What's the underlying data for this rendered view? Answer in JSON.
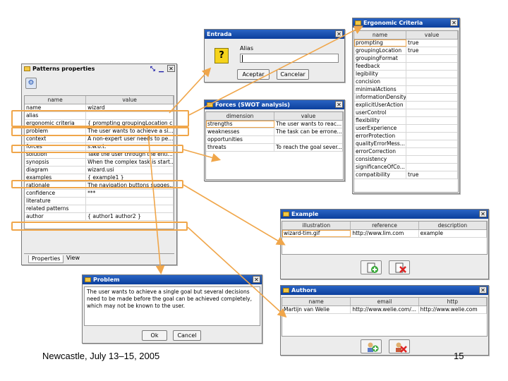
{
  "colors": {
    "titlebar": "#1b4fb0",
    "highlight": "#f0a64a",
    "window_bg": "#ececec"
  },
  "patterns_window": {
    "title": "Patterns properties",
    "columns": [
      "name",
      "value"
    ],
    "rows": [
      [
        "name",
        "wizard"
      ],
      [
        "alias",
        ""
      ],
      [
        "ergonomic criteria",
        "{ prompting groupingLocation c..."
      ],
      [
        "problem",
        "The user wants to achieve a si..."
      ],
      [
        "context",
        "A non-expert user needs to pe..."
      ],
      [
        "forces",
        "s.w.o.t."
      ],
      [
        "solution",
        "Take the user through the enti..."
      ],
      [
        "synopsis",
        "When the complex task is start..."
      ],
      [
        "diagram",
        "wizard.usi"
      ],
      [
        "examples",
        "{ example1 }"
      ],
      [
        "rationale",
        "The navigation buttons sugges..."
      ],
      [
        "confidence",
        "***"
      ],
      [
        "literature",
        ""
      ],
      [
        "related patterns",
        ""
      ],
      [
        "author",
        "{ author1 author2 }"
      ]
    ],
    "tabs": [
      "Properties",
      "View"
    ]
  },
  "entrada_window": {
    "title": "Entrada",
    "field_label": "Alias",
    "field_value": "",
    "icon_glyph": "?",
    "accept_label": "Aceptar",
    "cancel_label": "Cancelar"
  },
  "ergonomic_window": {
    "title": "Ergonomic Criteria",
    "columns": [
      "name",
      "value"
    ],
    "rows": [
      [
        "prompting",
        "true"
      ],
      [
        "groupingLocation",
        "true"
      ],
      [
        "groupingFormat",
        ""
      ],
      [
        "feedback",
        ""
      ],
      [
        "legibility",
        ""
      ],
      [
        "concision",
        ""
      ],
      [
        "minimalActions",
        ""
      ],
      [
        "informationDensity",
        ""
      ],
      [
        "explicitUserAction",
        ""
      ],
      [
        "userControl",
        ""
      ],
      [
        "flexibility",
        ""
      ],
      [
        "userExperience",
        ""
      ],
      [
        "errorProtection",
        ""
      ],
      [
        "qualityErrorMess...",
        ""
      ],
      [
        "errorCorrection",
        ""
      ],
      [
        "consistency",
        ""
      ],
      [
        "significanceOfCo...",
        ""
      ],
      [
        "compatibility",
        "true"
      ]
    ]
  },
  "forces_window": {
    "title": "Forces (SWOT analysis)",
    "columns": [
      "dimension",
      "value"
    ],
    "rows": [
      [
        "strengths",
        "The user wants to reac..."
      ],
      [
        "weaknesses",
        "The task can be errone..."
      ],
      [
        "opportunities",
        ""
      ],
      [
        "threats",
        "To reach the goal sever..."
      ]
    ]
  },
  "example_window": {
    "title": "Example",
    "columns": [
      "illustration",
      "reference",
      "description"
    ],
    "rows": [
      [
        "wizard-tim.gif",
        "http://www.lim.com",
        "example"
      ]
    ]
  },
  "problem_window": {
    "title": "Problem",
    "text": "The user wants to achieve a single goal but several decisions need to be made before the goal can be achieved completely, which may not be known to the user.",
    "ok_label": "Ok",
    "cancel_label": "Cancel"
  },
  "authors_window": {
    "title": "Authors",
    "columns": [
      "name",
      "email",
      "http"
    ],
    "rows": [
      [
        "Martijn van Welie",
        "http://www.welie.com/...",
        "http://www.welie.com"
      ]
    ]
  },
  "footer": {
    "venue": "Newcastle, July 13–15, 2005",
    "page_number": "15"
  }
}
